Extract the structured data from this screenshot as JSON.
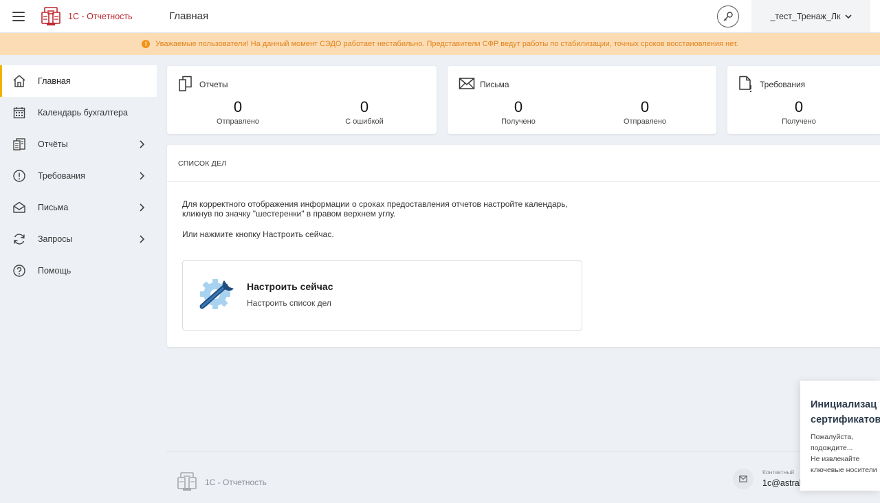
{
  "header": {
    "logo_text": "1С - Отчетность",
    "page_title": "Главная",
    "user_name": "_тест_Тренаж_Лк"
  },
  "banner": {
    "text": "Уважаемые пользователи! На данный момент СЭДО работает нестабильно. Представители СФР ведут работы по стабилизации, точных сроков восстановления нет.",
    "icon": "warning-icon",
    "color": "#f39219"
  },
  "sidebar": {
    "items": [
      {
        "label": "Главная",
        "icon": "home-icon",
        "active": true
      },
      {
        "label": "Календарь бухгалтера",
        "icon": "calendar-icon"
      },
      {
        "label": "Отчёты",
        "icon": "reports-icon",
        "expandable": true
      },
      {
        "label": "Требования",
        "icon": "alert-circle-icon",
        "expandable": true
      },
      {
        "label": "Письма",
        "icon": "envelope-open-icon",
        "expandable": true
      },
      {
        "label": "Запросы",
        "icon": "refresh-icon",
        "expandable": true
      },
      {
        "label": "Помощь",
        "icon": "help-icon"
      }
    ]
  },
  "stats": {
    "reports": {
      "title": "Отчеты",
      "a_value": "0",
      "a_label": "Отправлено",
      "b_value": "0",
      "b_label": "С ошибкой"
    },
    "letters": {
      "title": "Письма",
      "a_value": "0",
      "a_label": "Получено",
      "b_value": "0",
      "b_label": "Отправлено"
    },
    "demands": {
      "title": "Требования",
      "a_value": "0",
      "a_label": "Получено"
    }
  },
  "todo": {
    "heading": "СПИСОК ДЕЛ",
    "line1": "Для корректного отображения информации о сроках предоставления отчетов настройте календарь,",
    "line2": "кликнув по значку \"шестеренки\" в правом верхнем углу.",
    "line3": "Или нажмите кнопку Настроить сейчас.",
    "setup_title": "Настроить сейчас",
    "setup_subtitle": "Настроить список дел"
  },
  "footer": {
    "logo_text": "1С - Отчетность",
    "contact_label": "Контактный",
    "contact_value": "1c@astral"
  },
  "toast": {
    "title_line1": "Инициализац",
    "title_line2": "сертификатов",
    "body_line1": "Пожалуйста,",
    "body_line2": "подождите...",
    "body_line3": "Не извлекайте",
    "body_line4": "ключевые носители"
  },
  "colors": {
    "brand": "#c0262d",
    "active_marker": "#f0b400",
    "banner_bg": "#fcdcb4",
    "banner_text": "#e0841c"
  }
}
